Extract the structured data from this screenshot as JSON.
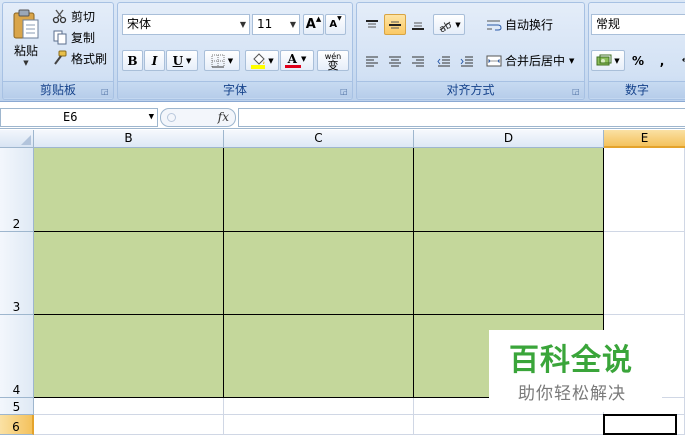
{
  "ribbon": {
    "clipboard": {
      "label": "剪贴板",
      "paste": "粘贴",
      "cut": "剪切",
      "copy": "复制",
      "format_painter": "格式刷"
    },
    "font": {
      "label": "字体",
      "font_name": "宋体",
      "font_size": "11",
      "bold": "B",
      "italic": "I",
      "underline": "U",
      "grow_font": "A",
      "shrink_font": "A",
      "font_color": "A",
      "phonetic": "wén"
    },
    "alignment": {
      "label": "对齐方式",
      "wrap_text": "自动换行",
      "merge_center": "合并后居中"
    },
    "number": {
      "label": "数字",
      "format": "常规",
      "percent": "%",
      "comma": ","
    }
  },
  "formula_bar": {
    "name_box": "E6",
    "fx": "fx",
    "formula": ""
  },
  "sheet": {
    "columns": [
      "B",
      "C",
      "D",
      "E"
    ],
    "selected_column": "E",
    "rows": [
      "2",
      "3",
      "4",
      "5",
      "6"
    ],
    "selected_row": "6",
    "active_cell": "E6",
    "fill_color": "#c4d79b",
    "fill_range": "B2:D4"
  },
  "watermark": {
    "title": "百科全说",
    "subtitle": "助你轻松解决"
  },
  "colors": {
    "ribbon_text": "#15428b",
    "header_selected": "#f4c25d",
    "watermark_green": "#3aa53a"
  }
}
